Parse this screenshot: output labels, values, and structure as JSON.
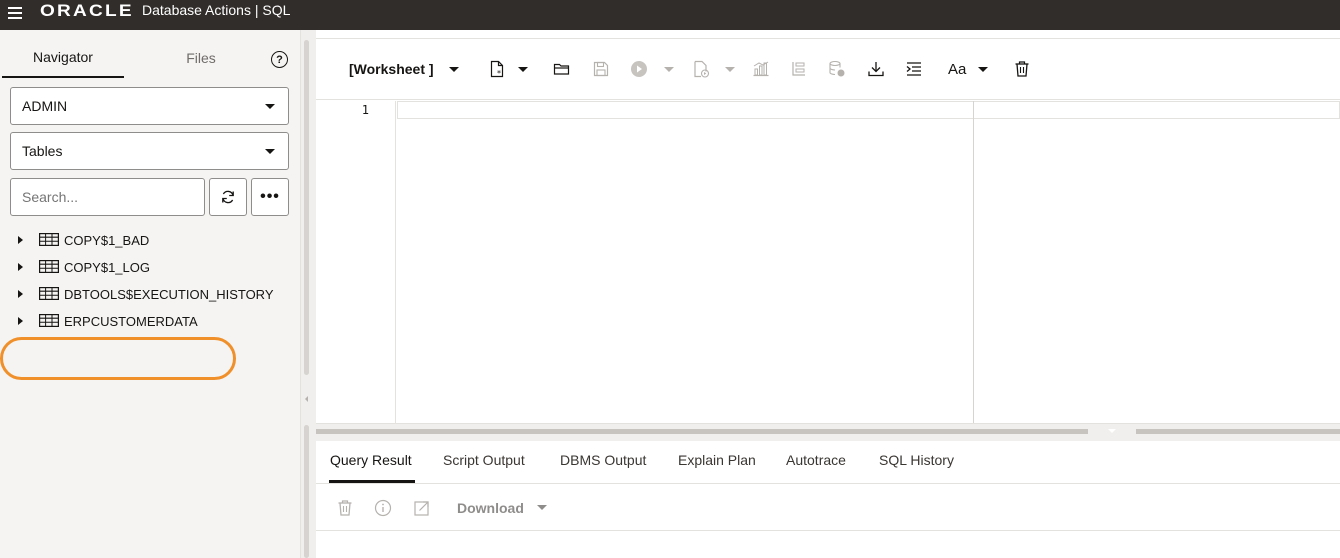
{
  "header": {
    "brand": "ORACLE",
    "product": "Database Actions |  SQL"
  },
  "navigator": {
    "tabs": [
      {
        "label": "Navigator",
        "active": true
      },
      {
        "label": "Files",
        "active": false
      }
    ],
    "help_symbol": "?",
    "schema_select": "ADMIN",
    "object_type_select": "Tables",
    "search_placeholder": "Search...",
    "more_symbol": "•••",
    "tables": [
      {
        "name": "COPY$1_BAD"
      },
      {
        "name": "COPY$1_LOG"
      },
      {
        "name": "DBTOOLS$EXECUTION_HISTORY"
      },
      {
        "name": "ERPCUSTOMERDATA",
        "highlighted": true
      }
    ],
    "highlight_color": "#f0902b"
  },
  "toolbar": {
    "worksheet_label": "[Worksheet ]",
    "font_size_glyph": "Aa",
    "icons": [
      "new-worksheet-icon",
      "open-folder-icon",
      "save-icon",
      "run-icon",
      "run-script-icon",
      "explain-plan-icon",
      "autotrace-icon",
      "sql-history-icon",
      "download-icon",
      "format-icon",
      "font-size-icon",
      "clear-icon"
    ]
  },
  "editor": {
    "line_numbers": [
      "1"
    ]
  },
  "results": {
    "tabs": [
      {
        "label": "Query Result",
        "active": true
      },
      {
        "label": "Script Output",
        "active": false
      },
      {
        "label": "DBMS Output",
        "active": false
      },
      {
        "label": "Explain Plan",
        "active": false
      },
      {
        "label": "Autotrace",
        "active": false
      },
      {
        "label": "SQL History",
        "active": false
      }
    ],
    "download_label": "Download"
  },
  "colors": {
    "topbar": "#312d2a",
    "panel": "#f5f4f2",
    "accent_highlight": "#f0902b"
  }
}
